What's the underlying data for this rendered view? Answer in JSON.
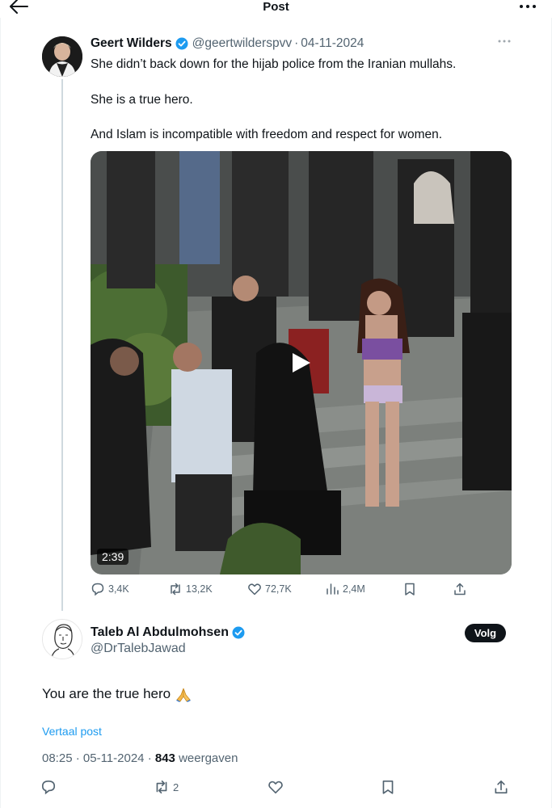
{
  "header": {
    "title": "Post"
  },
  "tweet": {
    "author_name": "Geert Wilders",
    "handle": "@geertwilderspvv",
    "date_separator": "·",
    "date": "04-11-2024",
    "paragraphs": [
      "She didn’t back down for the hijab police from the Iranian mullahs.",
      "She is a true hero.",
      "And Islam is incompatible with freedom and respect for women."
    ],
    "video": {
      "duration": "2:39"
    },
    "stats": {
      "replies": "3,4K",
      "reposts": "13,2K",
      "likes": "72,7K",
      "views": "2,4M"
    }
  },
  "reply": {
    "author_name": "Taleb Al Abdulmohsen",
    "handle": "@DrTalebJawad",
    "follow_label": "Volg",
    "text": "You are the true hero",
    "translate_label": "Vertaal post",
    "time": "08:25",
    "date_separator": "·",
    "date": "05-11-2024",
    "views_separator": "·",
    "views_count": "843",
    "views_label": "weergaven",
    "reposts": "2"
  },
  "colors": {
    "text_primary": "#0f1419",
    "text_secondary": "#536471",
    "accent": "#1d9bf0",
    "follow_bg": "#0f1419"
  },
  "icons": {
    "back": "arrow-left-icon",
    "more": "more-horizontal-icon",
    "verified": "verified-badge-icon",
    "play": "play-icon",
    "reply": "reply-icon",
    "repost": "repost-icon",
    "like": "heart-icon",
    "views": "views-icon",
    "bookmark": "bookmark-icon",
    "share": "share-icon",
    "emoji": "folded-hands-icon"
  }
}
